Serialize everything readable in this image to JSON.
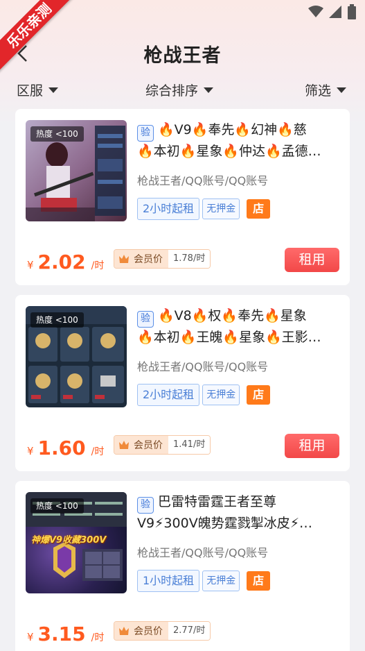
{
  "ribbon": {
    "text": "乐乐亲测"
  },
  "header": {
    "title": "枪战王者"
  },
  "filters": [
    {
      "label": "区服"
    },
    {
      "label": "综合排序"
    },
    {
      "label": "筛选"
    }
  ],
  "listings": [
    {
      "heat": "热度 <100",
      "verify": "验",
      "title_line1": [
        "🔥V9",
        "🔥奉先",
        "🔥幻神",
        "🔥慈"
      ],
      "title_line2": "🔥本初🔥星象🔥仲达🔥孟德…",
      "tags": "枪战王者/QQ账号/QQ账号",
      "min_rent": "2小时起租",
      "deposit": "无押金",
      "store": "店",
      "currency": "¥",
      "price": "2.02",
      "unit": "/时",
      "member_label": "会员价",
      "member_price": "1.78/时",
      "rent_label": "租用"
    },
    {
      "heat": "热度 <100",
      "verify": "验",
      "title_line1": [
        "🔥V8",
        "🔥权",
        "🔥奉先",
        "🔥星象"
      ],
      "title_line2": "🔥本初🔥王魄🔥星象🔥王影…",
      "tags": "枪战王者/QQ账号/QQ账号",
      "min_rent": "2小时起租",
      "deposit": "无押金",
      "store": "店",
      "currency": "¥",
      "price": "1.60",
      "unit": "/时",
      "member_label": "会员价",
      "member_price": "1.41/时",
      "rent_label": "租用"
    },
    {
      "heat": "热度 <100",
      "verify": "验",
      "caption": "神爆V9收藏300V",
      "title_line1": [
        "巴雷特雷霆王者至尊"
      ],
      "title_line2": "V9⚡300V魄势霆戮掣冰皮⚡…",
      "tags": "枪战王者/QQ账号/QQ账号",
      "min_rent": "1小时起租",
      "deposit": "无押金",
      "store": "店",
      "currency": "¥",
      "price": "3.15",
      "unit": "/时",
      "member_label": "会员价",
      "member_price": "2.77/时"
    }
  ]
}
